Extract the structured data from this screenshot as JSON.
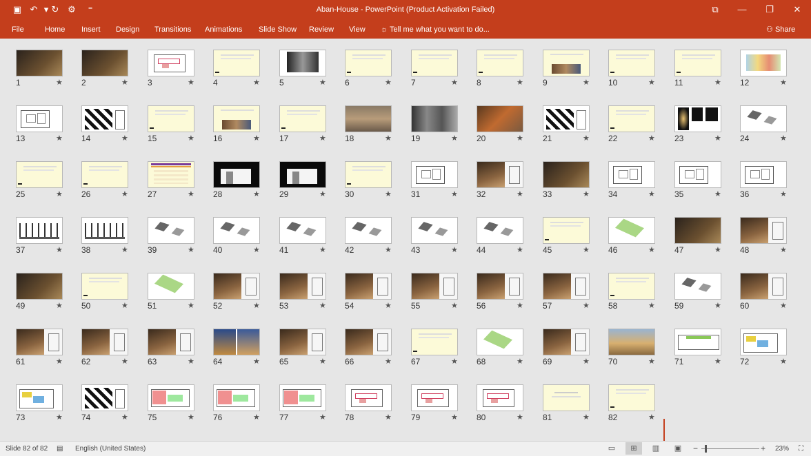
{
  "window": {
    "title": "Aban-House - PowerPoint (Product Activation Failed)",
    "quick_access": [
      {
        "name": "save-icon",
        "glyph": "▣"
      },
      {
        "name": "undo-icon",
        "glyph": "↶"
      },
      {
        "name": "undo-dropdown-icon",
        "glyph": "▾"
      },
      {
        "name": "redo-icon",
        "glyph": "↻"
      },
      {
        "name": "start-from-beginning-icon",
        "glyph": "⚙"
      },
      {
        "name": "customize-toolbar-icon",
        "glyph": "⁼"
      }
    ],
    "controls": [
      {
        "name": "ribbon-display-options-icon",
        "glyph": "⧉"
      },
      {
        "name": "minimize-icon",
        "glyph": "—"
      },
      {
        "name": "restore-icon",
        "glyph": "❐"
      },
      {
        "name": "close-icon",
        "glyph": "✕"
      }
    ]
  },
  "ribbon": {
    "tabs": [
      "File",
      "Home",
      "Insert",
      "Design",
      "Transitions",
      "Animations",
      "Slide Show",
      "Review",
      "View"
    ],
    "tell_me": "Tell me what you want to do...",
    "share": "Share"
  },
  "accent_color": "#c43e1c",
  "slides": [
    {
      "n": "1",
      "t": "photo-dark"
    },
    {
      "n": "2",
      "t": "photo-dark"
    },
    {
      "n": "3",
      "t": "plan-red"
    },
    {
      "n": "4",
      "t": "text"
    },
    {
      "n": "5",
      "t": "photo-bw"
    },
    {
      "n": "6",
      "t": "text"
    },
    {
      "n": "7",
      "t": "text"
    },
    {
      "n": "8",
      "t": "text"
    },
    {
      "n": "9",
      "t": "text-photo"
    },
    {
      "n": "10",
      "t": "text"
    },
    {
      "n": "11",
      "t": "text"
    },
    {
      "n": "12",
      "t": "site-map"
    },
    {
      "n": "13",
      "t": "plan"
    },
    {
      "n": "14",
      "t": "plan-black"
    },
    {
      "n": "15",
      "t": "text"
    },
    {
      "n": "16",
      "t": "text-photo"
    },
    {
      "n": "17",
      "t": "text"
    },
    {
      "n": "18",
      "t": "photo-aerial"
    },
    {
      "n": "19",
      "t": "photo-grey"
    },
    {
      "n": "20",
      "t": "photo-orange"
    },
    {
      "n": "21",
      "t": "plan-black"
    },
    {
      "n": "22",
      "t": "text"
    },
    {
      "n": "23",
      "t": "photo-black"
    },
    {
      "n": "24",
      "t": "iso"
    },
    {
      "n": "25",
      "t": "text"
    },
    {
      "n": "26",
      "t": "text"
    },
    {
      "n": "27",
      "t": "table"
    },
    {
      "n": "28",
      "t": "section-black"
    },
    {
      "n": "29",
      "t": "section-black"
    },
    {
      "n": "30",
      "t": "text"
    },
    {
      "n": "31",
      "t": "plan"
    },
    {
      "n": "32",
      "t": "photo-warm"
    },
    {
      "n": "33",
      "t": "photo-dark"
    },
    {
      "n": "34",
      "t": "plan"
    },
    {
      "n": "35",
      "t": "plan"
    },
    {
      "n": "36",
      "t": "plan"
    },
    {
      "n": "37",
      "t": "section"
    },
    {
      "n": "38",
      "t": "section"
    },
    {
      "n": "39",
      "t": "iso"
    },
    {
      "n": "40",
      "t": "iso"
    },
    {
      "n": "41",
      "t": "iso"
    },
    {
      "n": "42",
      "t": "iso"
    },
    {
      "n": "43",
      "t": "iso"
    },
    {
      "n": "44",
      "t": "iso"
    },
    {
      "n": "45",
      "t": "text"
    },
    {
      "n": "46",
      "t": "iso-green"
    },
    {
      "n": "47",
      "t": "photo-dark"
    },
    {
      "n": "48",
      "t": "photo-warm"
    },
    {
      "n": "49",
      "t": "photo-dark"
    },
    {
      "n": "50",
      "t": "text"
    },
    {
      "n": "51",
      "t": "iso-green"
    },
    {
      "n": "52",
      "t": "photo-warm"
    },
    {
      "n": "53",
      "t": "photo-warm"
    },
    {
      "n": "54",
      "t": "photo-warm"
    },
    {
      "n": "55",
      "t": "photo-warm"
    },
    {
      "n": "56",
      "t": "photo-warm"
    },
    {
      "n": "57",
      "t": "photo-warm"
    },
    {
      "n": "58",
      "t": "text"
    },
    {
      "n": "59",
      "t": "iso"
    },
    {
      "n": "60",
      "t": "photo-warm"
    },
    {
      "n": "61",
      "t": "photo-warm"
    },
    {
      "n": "62",
      "t": "photo-warm"
    },
    {
      "n": "63",
      "t": "photo-warm"
    },
    {
      "n": "64",
      "t": "photo-blue"
    },
    {
      "n": "65",
      "t": "photo-warm"
    },
    {
      "n": "66",
      "t": "photo-warm"
    },
    {
      "n": "67",
      "t": "text"
    },
    {
      "n": "68",
      "t": "iso-green"
    },
    {
      "n": "69",
      "t": "photo-warm"
    },
    {
      "n": "70",
      "t": "photo-sky"
    },
    {
      "n": "71",
      "t": "plan-green"
    },
    {
      "n": "72",
      "t": "plan-color"
    },
    {
      "n": "73",
      "t": "plan-color"
    },
    {
      "n": "74",
      "t": "plan-black"
    },
    {
      "n": "75",
      "t": "plan-pink"
    },
    {
      "n": "76",
      "t": "plan-pink"
    },
    {
      "n": "77",
      "t": "plan-pink"
    },
    {
      "n": "78",
      "t": "plan-red"
    },
    {
      "n": "79",
      "t": "plan-red"
    },
    {
      "n": "80",
      "t": "plan-red"
    },
    {
      "n": "81",
      "t": "text-center"
    },
    {
      "n": "82",
      "t": "text"
    }
  ],
  "status": {
    "slide_info": "Slide 82 of 82",
    "language": "English (United States)",
    "zoom": "23%",
    "view_buttons": [
      {
        "name": "normal-view-icon",
        "glyph": "▭"
      },
      {
        "name": "slide-sorter-view-icon",
        "glyph": "⊞"
      },
      {
        "name": "reading-view-icon",
        "glyph": "▥"
      },
      {
        "name": "slideshow-view-icon",
        "glyph": "▣"
      }
    ]
  }
}
